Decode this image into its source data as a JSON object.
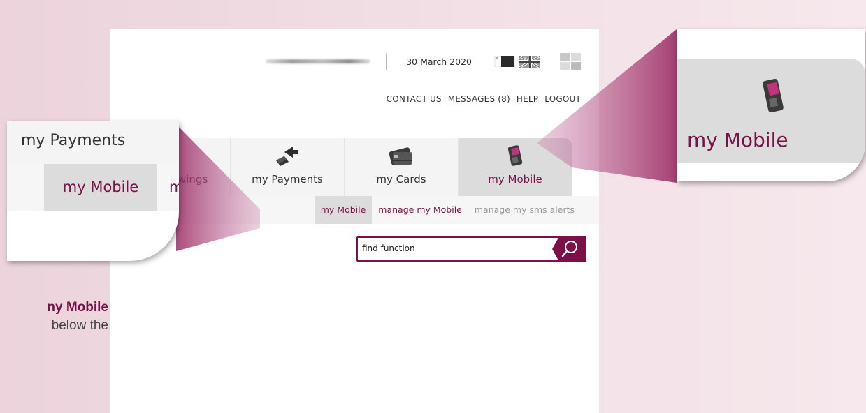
{
  "header": {
    "date": "30 March 2020",
    "links": [
      "CONTACT US",
      "MESSAGES (8)",
      "HELP",
      "LOGOUT"
    ]
  },
  "nav": {
    "tabs": [
      {
        "label": "wings",
        "icon": "partial-icon"
      },
      {
        "label": "my Payments",
        "icon": "payments-icon"
      },
      {
        "label": "my Cards",
        "icon": "cards-icon"
      },
      {
        "label": "my Mobile",
        "icon": "mobile-phone-icon",
        "active": true
      }
    ]
  },
  "subnav": {
    "items": [
      "my Mobile",
      "manage my Mobile",
      "manage my sms alerts"
    ]
  },
  "search": {
    "placeholder": "find function"
  },
  "zoom_left": {
    "tab_label": "my Payments",
    "active_label": "my Mobile",
    "cut_label": "m"
  },
  "zoom_right": {
    "label": "my Mobile"
  },
  "side_text": {
    "line1": "ny Mobile",
    "line2": "below  the"
  },
  "colors": {
    "accent": "#7a1149",
    "background": "#f1dde4"
  }
}
